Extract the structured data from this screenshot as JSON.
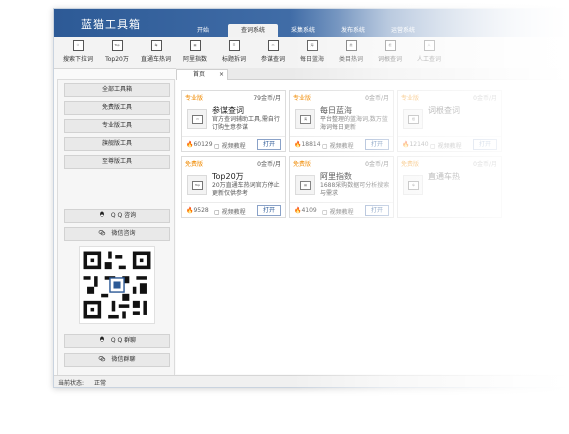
{
  "app": {
    "title": "蓝猫工具箱"
  },
  "tabs": [
    "开始",
    "查词系统",
    "采集系统",
    "发布系统",
    "运营系统"
  ],
  "active_tab": "查词系统",
  "toolbar": [
    {
      "label": "搜索下拉词",
      "icon": "search-dropdown-icon",
      "glyph": "⚇"
    },
    {
      "label": "Top20万",
      "icon": "top-icon",
      "glyph": "Top"
    },
    {
      "label": "直通车热词",
      "icon": "car-icon",
      "glyph": "车"
    },
    {
      "label": "阿里指数",
      "icon": "chart-icon",
      "glyph": "▤"
    },
    {
      "label": "标题拆词",
      "icon": "split-icon",
      "glyph": "☰"
    },
    {
      "label": "参谋查词",
      "icon": "advisor-icon",
      "glyph": "▭"
    },
    {
      "label": "每日蓝海",
      "icon": "sea-icon",
      "glyph": "海"
    },
    {
      "label": "类目热词",
      "icon": "category-icon",
      "glyph": "类"
    },
    {
      "label": "词根查词",
      "icon": "root-icon",
      "glyph": "根"
    },
    {
      "label": "人工查词",
      "icon": "person-icon",
      "glyph": "人"
    }
  ],
  "home_tab": {
    "label": "首页",
    "close": "×"
  },
  "sidebar": {
    "categories": [
      "全部工具箱",
      "免费版工具",
      "专业版工具",
      "旗舰版工具",
      "至尊版工具"
    ],
    "qq_consult": "Q Q 咨询",
    "wechat_consult": "微信咨询",
    "qq_group": "Q Q 群聊",
    "wechat_group": "微信群聊"
  },
  "cards": [
    {
      "badge": "专业版",
      "price": "79金币/月",
      "title": "参谋查词",
      "desc": "官方查词辅助工具,需自行订购生意参谋",
      "fire": "60129",
      "video": "视频教程",
      "open": "打开",
      "glyph": "▭"
    },
    {
      "badge": "专业版",
      "price": "0金币/月",
      "title": "每日蓝海",
      "desc": "平台整理的蓝海词,数万蓝海词每日更新",
      "fire": "18814",
      "video": "视频教程",
      "open": "打开",
      "glyph": "海"
    },
    {
      "badge": "专业版",
      "price": "0金币/月",
      "title": "词根查词",
      "desc": "",
      "fire": "12140",
      "video": "视频教程",
      "open": "打开",
      "glyph": "根"
    },
    {
      "badge": "免费版",
      "price": "0金币/月",
      "title": "Top20万",
      "desc": "20万直通车热词官方停止更新仅供参考",
      "fire": "9528",
      "video": "视频教程",
      "open": "打开",
      "glyph": "Top"
    },
    {
      "badge": "免费版",
      "price": "0金币/月",
      "title": "阿里指数",
      "desc": "1688采购数据可分析搜索与需求",
      "fire": "4109",
      "video": "视频教程",
      "open": "打开",
      "glyph": "▤"
    },
    {
      "badge": "免费版",
      "price": "0金币/月",
      "title": "直通车热",
      "desc": "",
      "fire": "",
      "video": "",
      "open": "",
      "glyph": "车"
    }
  ],
  "status": {
    "label": "当前状态:",
    "value": "正常"
  }
}
